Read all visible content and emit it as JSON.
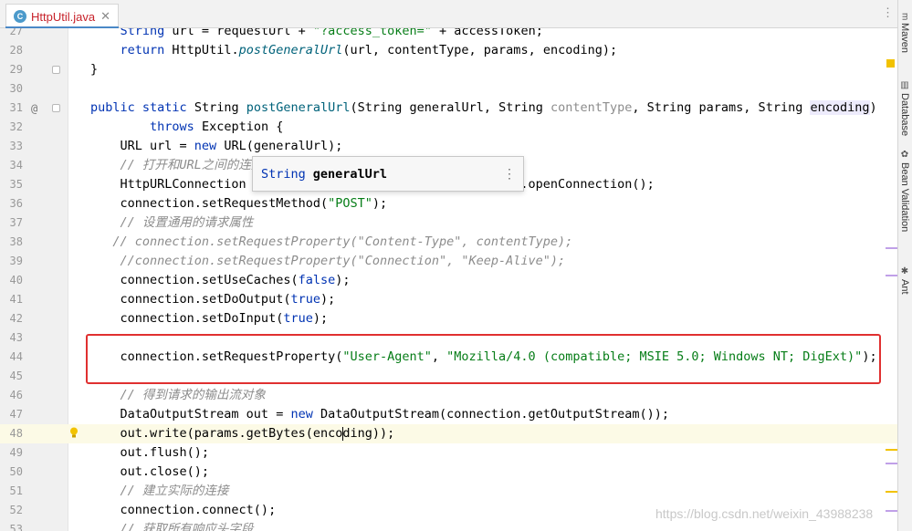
{
  "tab": {
    "icon_letter": "C",
    "title": "HttpUtil.java",
    "close": "✕"
  },
  "tabbar_more": "⋮",
  "tool_windows": [
    {
      "label": "Maven",
      "icon": "m"
    },
    {
      "label": "Database",
      "icon": "▥"
    },
    {
      "label": "Bean Validation",
      "icon": "✿"
    },
    {
      "label": "Ant",
      "icon": "✱"
    }
  ],
  "gutter": {
    "override_marker": "@"
  },
  "param_popup": {
    "type": "String",
    "name": "generalUrl",
    "more": "⋮"
  },
  "lines": [
    {
      "num": "27",
      "text": "    String url = requestUrl + \"?access_token=\" + accessToken;"
    },
    {
      "num": "28",
      "text": "    return HttpUtil.postGeneralUrl(url, contentType, params, encoding);"
    },
    {
      "num": "29",
      "text": "}"
    },
    {
      "num": "30",
      "text": ""
    },
    {
      "num": "31",
      "text": "public static String postGeneralUrl(String generalUrl, String contentType, String params, String encoding)"
    },
    {
      "num": "32",
      "text": "        throws Exception {"
    },
    {
      "num": "33",
      "text": "    URL url = new URL(generalUrl);"
    },
    {
      "num": "34",
      "text": "    // 打开和URL之间的连接"
    },
    {
      "num": "35",
      "text": "    HttpURLConnection connection = (HttpURLConnection) url.openConnection();"
    },
    {
      "num": "36",
      "text": "    connection.setRequestMethod(\"POST\");"
    },
    {
      "num": "37",
      "text": "    // 设置通用的请求属性"
    },
    {
      "num": "38",
      "text": "   // connection.setRequestProperty(\"Content-Type\", contentType);"
    },
    {
      "num": "39",
      "text": "    //connection.setRequestProperty(\"Connection\", \"Keep-Alive\");"
    },
    {
      "num": "40",
      "text": "    connection.setUseCaches(false);"
    },
    {
      "num": "41",
      "text": "    connection.setDoOutput(true);"
    },
    {
      "num": "42",
      "text": "    connection.setDoInput(true);"
    },
    {
      "num": "43",
      "text": ""
    },
    {
      "num": "44",
      "text": "    connection.setRequestProperty(\"User-Agent\", \"Mozilla/4.0 (compatible; MSIE 5.0; Windows NT; DigExt)\");"
    },
    {
      "num": "45",
      "text": ""
    },
    {
      "num": "46",
      "text": "    // 得到请求的输出流对象"
    },
    {
      "num": "47",
      "text": "    DataOutputStream out = new DataOutputStream(connection.getOutputStream());"
    },
    {
      "num": "48",
      "text": "    out.write(params.getBytes(encoding));"
    },
    {
      "num": "49",
      "text": "    out.flush();"
    },
    {
      "num": "50",
      "text": "    out.close();"
    },
    {
      "num": "51",
      "text": "    // 建立实际的连接"
    },
    {
      "num": "52",
      "text": "    connection.connect();"
    },
    {
      "num": "53",
      "text": "    // 获取所有响应头字段"
    }
  ],
  "tokens": {
    "kw_return": "return",
    "kw_public": "public",
    "kw_static": "static",
    "kw_throws": "throws",
    "kw_new": "new",
    "kw_false": "false",
    "kw_true": "true"
  },
  "watermark": "https://blog.csdn.net/weixin_43988238",
  "colors": {
    "keyword": "#0033b3",
    "string": "#067d17",
    "comment": "#8c8c8c",
    "method": "#00627a",
    "highlight_box": "#e03030"
  }
}
